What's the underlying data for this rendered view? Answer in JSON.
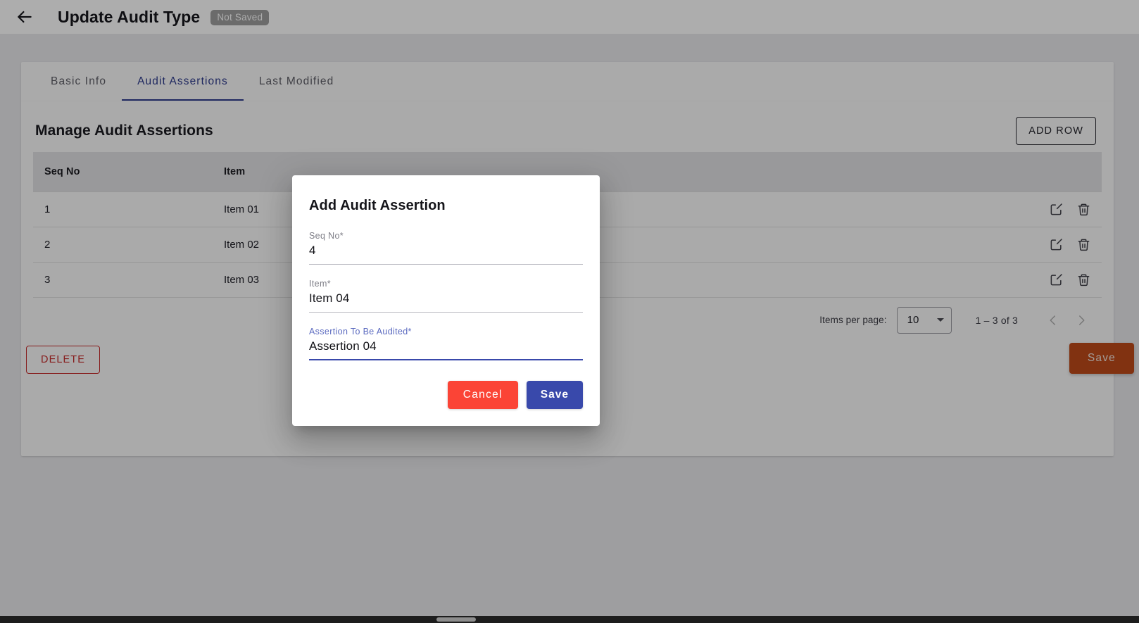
{
  "appbar": {
    "back_icon": "arrow-left-icon",
    "title": "Update Audit Type",
    "status_badge": "Not Saved"
  },
  "tabs": [
    {
      "label": "Basic Info",
      "active": false
    },
    {
      "label": "Audit Assertions",
      "active": true
    },
    {
      "label": "Last Modified",
      "active": false
    }
  ],
  "section": {
    "title": "Manage Audit Assertions",
    "add_row_label": "ADD ROW"
  },
  "table": {
    "columns": [
      "Seq No",
      "Item",
      "",
      ""
    ],
    "rows": [
      {
        "seq": "1",
        "item": "Item 01",
        "assertion": "",
        "edit_icon": "edit-icon",
        "delete_icon": "trash-icon"
      },
      {
        "seq": "2",
        "item": "Item 02",
        "assertion": "",
        "edit_icon": "edit-icon",
        "delete_icon": "trash-icon"
      },
      {
        "seq": "3",
        "item": "Item 03",
        "assertion": "",
        "edit_icon": "edit-icon",
        "delete_icon": "trash-icon"
      }
    ]
  },
  "paginator": {
    "items_per_page_label": "Items per page:",
    "page_size": "10",
    "range_label": "1 – 3 of 3",
    "prev_icon": "chevron-left-icon",
    "next_icon": "chevron-right-icon"
  },
  "footer": {
    "delete_label": "DELETE",
    "save_label": "Save"
  },
  "dialog": {
    "title": "Add Audit Assertion",
    "fields": [
      {
        "label": "Seq No*",
        "value": "4",
        "focused": false
      },
      {
        "label": "Item*",
        "value": "Item 04",
        "focused": false
      },
      {
        "label": "Assertion To Be Audited*",
        "value": "Assertion 04",
        "focused": true
      }
    ],
    "cancel_label": "Cancel",
    "save_label": "Save"
  },
  "colors": {
    "accent_blue": "#3949ab",
    "tab_active": "#2d3a8c",
    "cancel_red": "#fb4436",
    "delete_red": "#c62828",
    "save_orange": "#bf4a1a",
    "page_bg": "#e9e9ec",
    "card_bg": "#fbfbfb",
    "table_header_bg": "#e2e2e5"
  }
}
